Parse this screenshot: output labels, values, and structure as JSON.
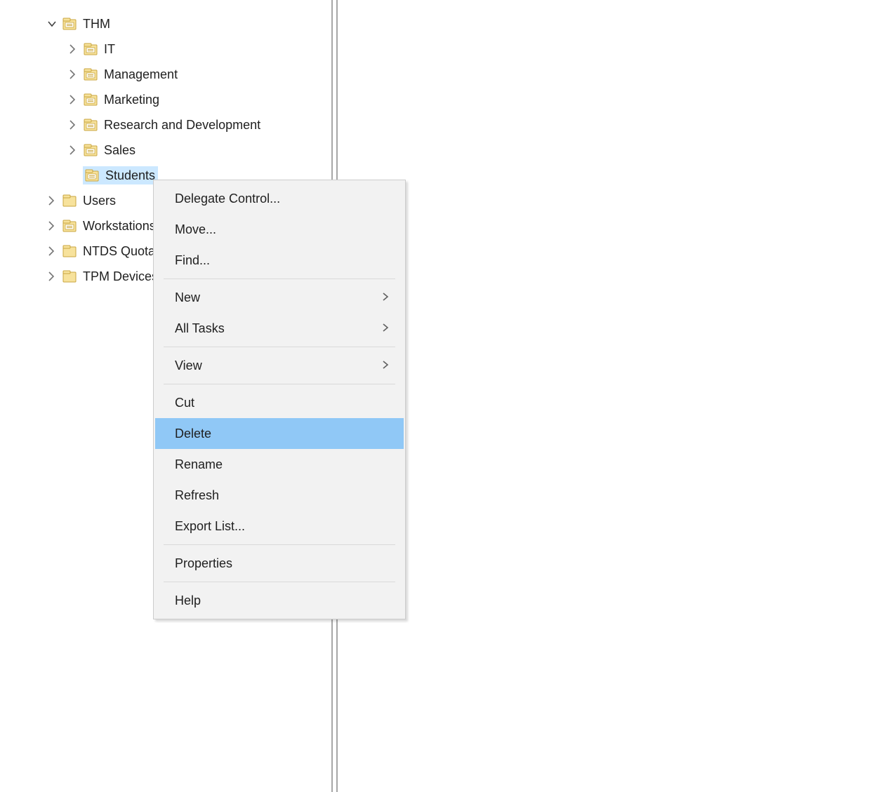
{
  "tree": {
    "root": {
      "label": "THM",
      "iconType": "ou",
      "expanded": true,
      "children": [
        {
          "label": "IT",
          "iconType": "ou",
          "expanded": false
        },
        {
          "label": "Management",
          "iconType": "ou",
          "expanded": false
        },
        {
          "label": "Marketing",
          "iconType": "ou",
          "expanded": false
        },
        {
          "label": "Research and Development",
          "iconType": "ou",
          "expanded": false
        },
        {
          "label": "Sales",
          "iconType": "ou",
          "expanded": false
        },
        {
          "label": "Students",
          "iconType": "ou",
          "expanded": false,
          "selected": true
        }
      ]
    },
    "siblings": [
      {
        "label": "Users",
        "iconType": "folder",
        "expanded": false
      },
      {
        "label": "Workstations",
        "iconType": "ou",
        "expanded": false,
        "truncatedLabel": "Workst"
      },
      {
        "label": "NTDS Quotas",
        "iconType": "folder",
        "expanded": false,
        "truncatedLabel": "NTDS Q"
      },
      {
        "label": "TPM Devices",
        "iconType": "folder",
        "expanded": false,
        "truncatedLabel": "TPM De"
      }
    ]
  },
  "contextMenu": {
    "items": [
      {
        "label": "Delegate Control...",
        "type": "item"
      },
      {
        "label": "Move...",
        "type": "item"
      },
      {
        "label": "Find...",
        "type": "item"
      },
      {
        "type": "separator"
      },
      {
        "label": "New",
        "type": "submenu"
      },
      {
        "label": "All Tasks",
        "type": "submenu"
      },
      {
        "type": "separator"
      },
      {
        "label": "View",
        "type": "submenu"
      },
      {
        "type": "separator"
      },
      {
        "label": "Cut",
        "type": "item"
      },
      {
        "label": "Delete",
        "type": "item",
        "highlighted": true
      },
      {
        "label": "Rename",
        "type": "item"
      },
      {
        "label": "Refresh",
        "type": "item"
      },
      {
        "label": "Export List...",
        "type": "item"
      },
      {
        "type": "separator"
      },
      {
        "label": "Properties",
        "type": "item"
      },
      {
        "type": "separator"
      },
      {
        "label": "Help",
        "type": "item"
      }
    ]
  }
}
